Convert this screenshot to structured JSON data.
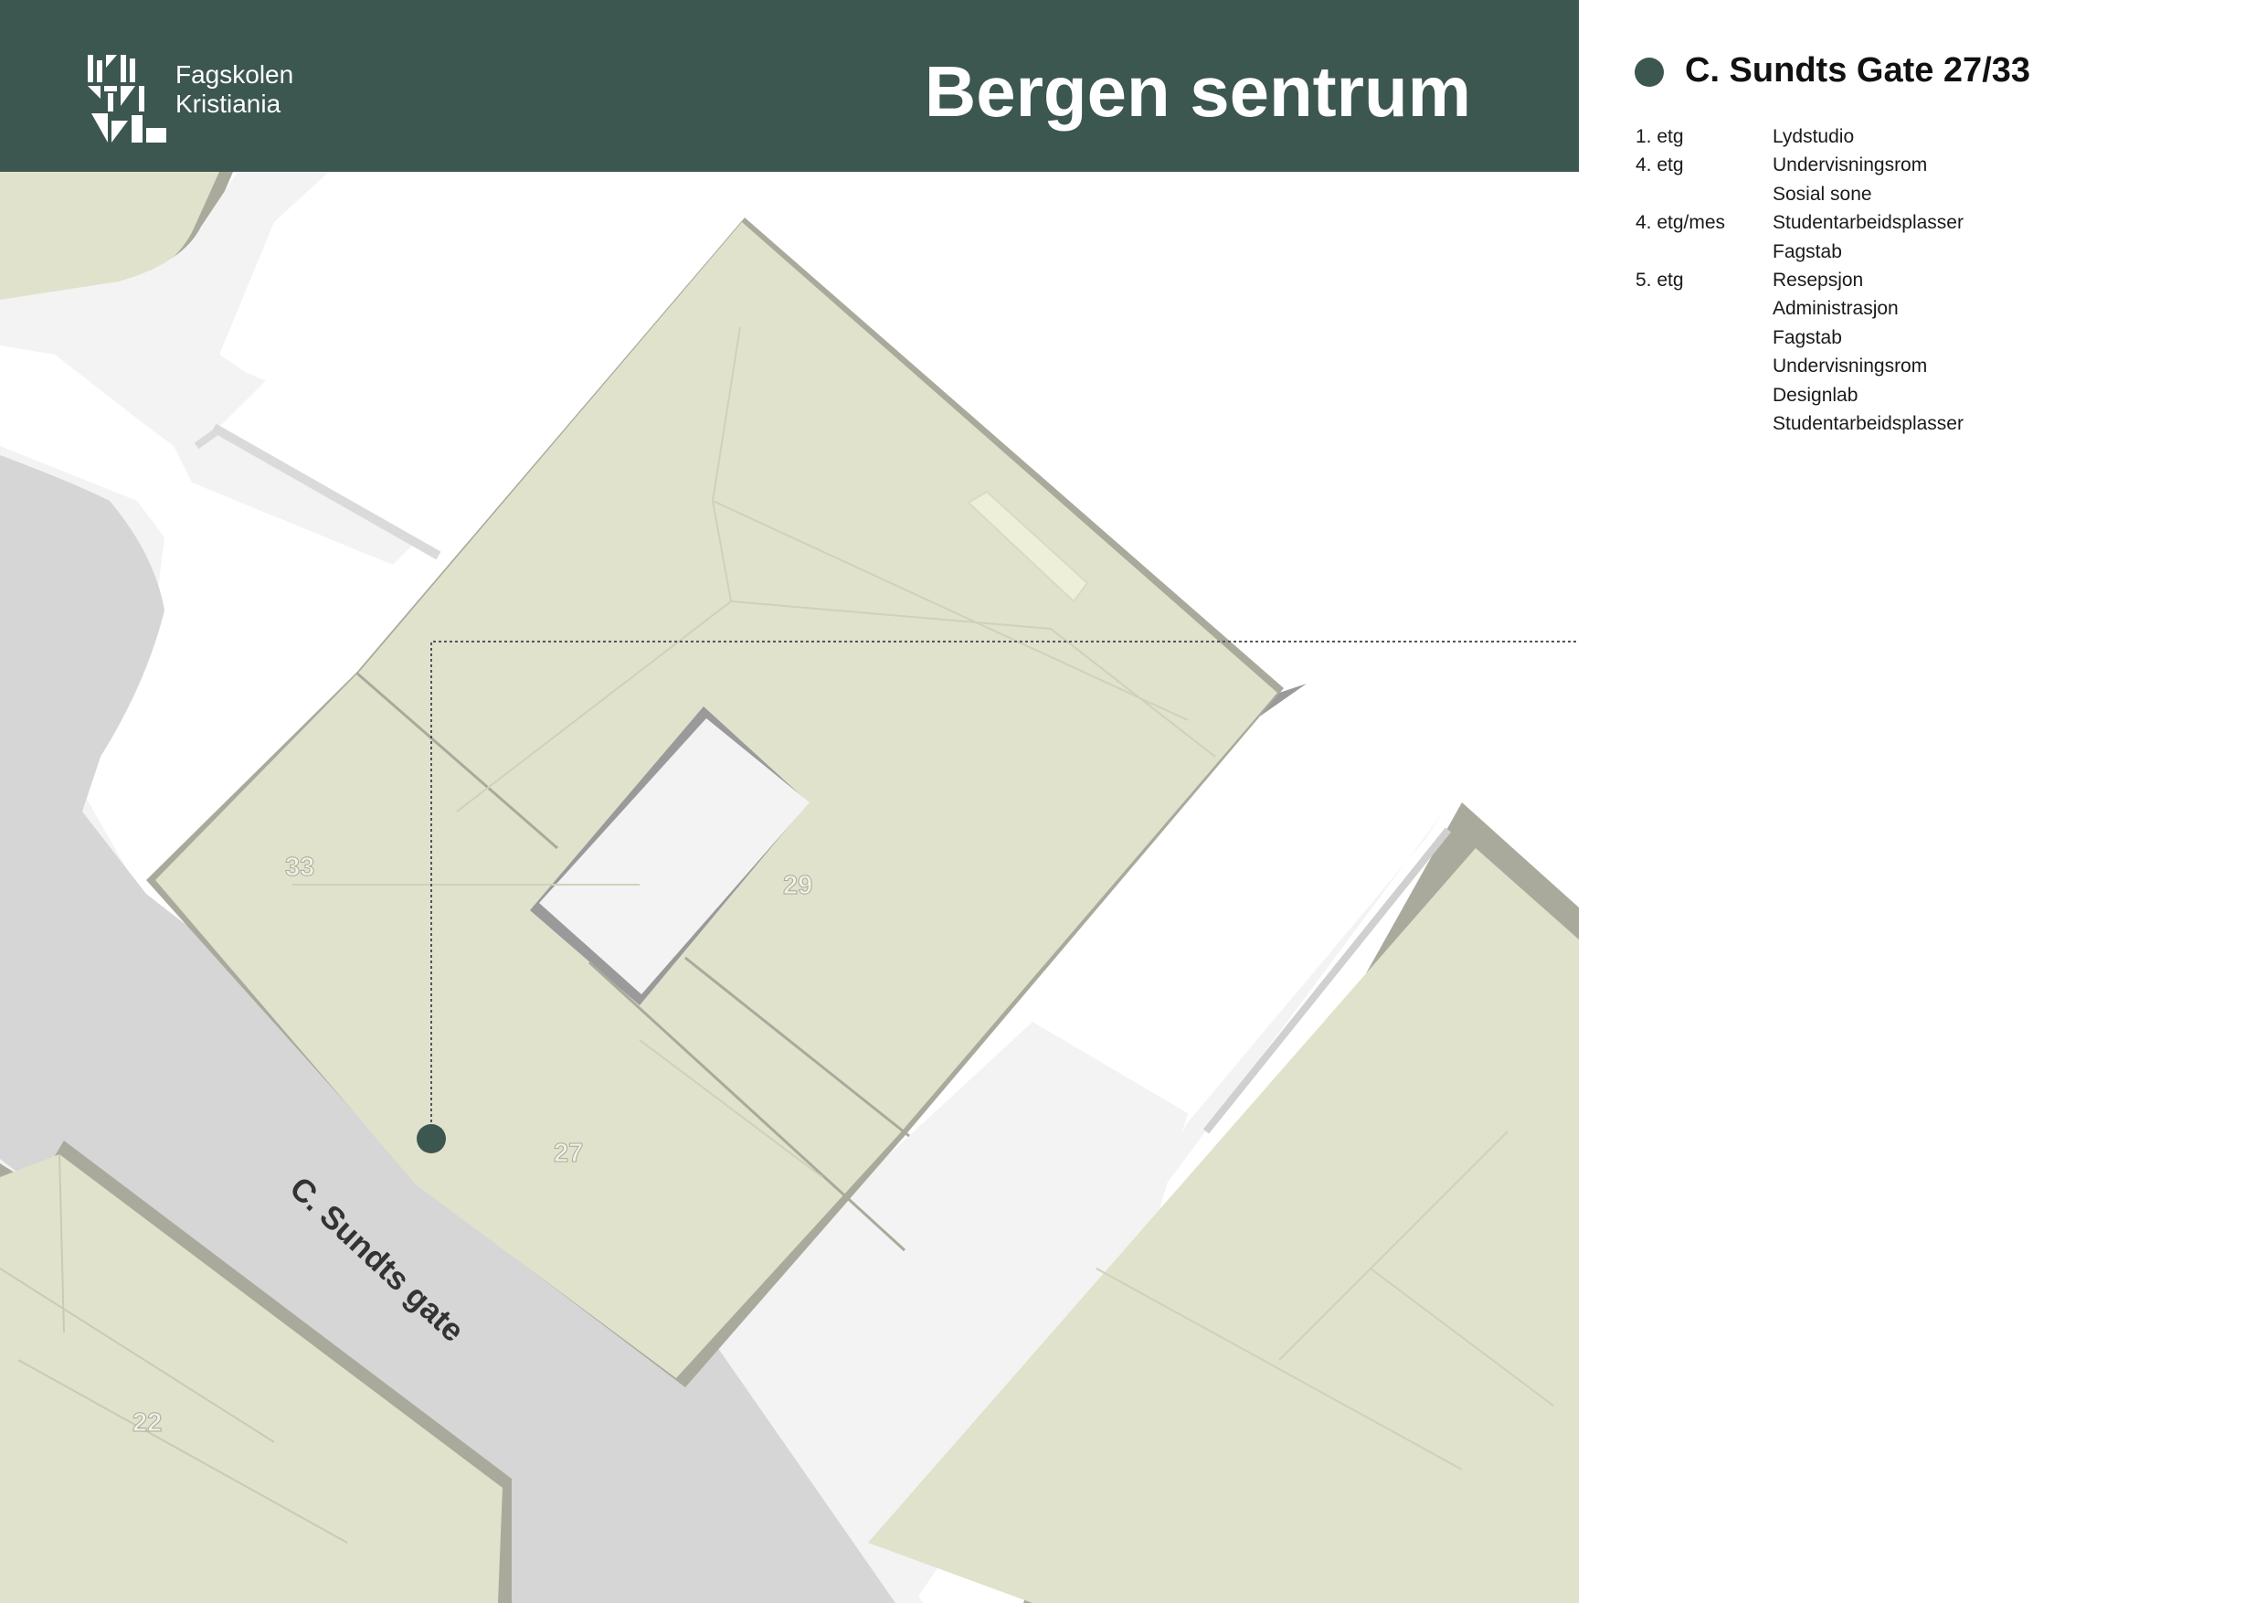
{
  "header": {
    "logo_line1": "Fagskolen",
    "logo_line2": "Kristiania",
    "title": "Bergen sentrum"
  },
  "location": {
    "name": "C. Sundts Gate 27/33",
    "marker_color": "#3c5650",
    "floors": [
      {
        "floor": "1. etg",
        "item": "Lydstudio"
      },
      {
        "floor": "4. etg",
        "item": "Undervisningsrom"
      },
      {
        "floor": "",
        "item": "Sosial sone"
      },
      {
        "floor": "4. etg/mes",
        "item": "Studentarbeidsplasser"
      },
      {
        "floor": "",
        "item": "Fagstab"
      },
      {
        "floor": "5. etg",
        "item": "Resepsjon"
      },
      {
        "floor": "",
        "item": "Administrasjon"
      },
      {
        "floor": "",
        "item": "Fagstab"
      },
      {
        "floor": "",
        "item": "Undervisningsrom"
      },
      {
        "floor": "",
        "item": "Designlab"
      },
      {
        "floor": "",
        "item": "Studentarbeidsplasser"
      }
    ]
  },
  "map": {
    "street_name": "C. Sundts gate",
    "building_numbers": {
      "b33": "33",
      "b29": "29",
      "b27": "27",
      "b22": "22"
    },
    "colors": {
      "building": "#e0e2cc",
      "road": "#d6d6d6",
      "sidewalk": "#f3f3f3",
      "header": "#3c5650"
    }
  }
}
